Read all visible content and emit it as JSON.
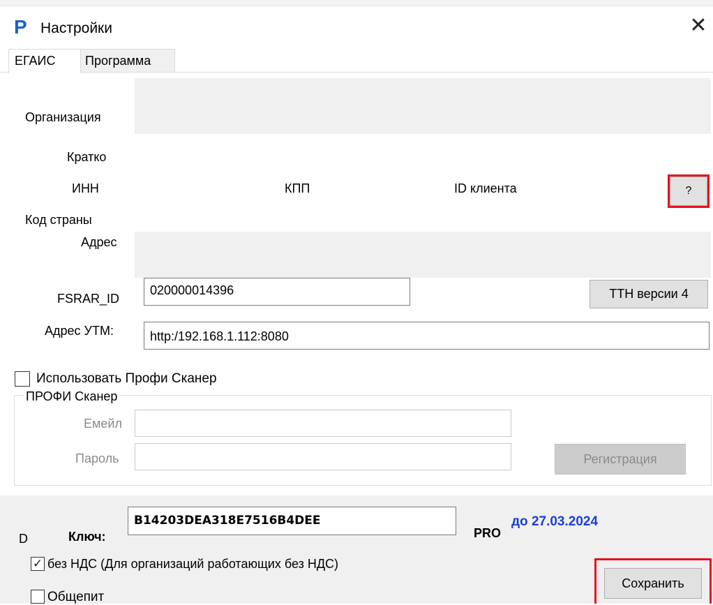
{
  "window": {
    "logo": "P",
    "title": "Настройки",
    "close": "✕"
  },
  "tabs": [
    {
      "label": "ЕГАИС"
    },
    {
      "label": "Программа"
    }
  ],
  "egais": {
    "org_label": "Организация",
    "short_label": "Кратко",
    "inn_label": "ИНН",
    "kpp_label": "КПП",
    "client_id_label": "ID клиента",
    "help_button": "?",
    "country_label": "Код страны",
    "address_label": "Адрес",
    "fsrar_label": "FSRAR_ID",
    "fsrar_value": "020000014396",
    "ttn_button": "ТТН версии 4",
    "utm_label": "Адрес УТМ:",
    "utm_value": "http:/192.168.1.112:8080"
  },
  "profi": {
    "use_checkbox_label": "Использовать Профи Сканер",
    "use_checked": false,
    "group_title": "ПРОФИ Сканер",
    "email_label": "Емейл",
    "email_value": "",
    "password_label": "Пароль",
    "password_value": "",
    "register_button": "Регистрация"
  },
  "license": {
    "d_label": "D",
    "key_label": "Ключ:",
    "key_value": "B14203DEA318E7516B4DEE",
    "edition": "PRO",
    "valid_until": "до 27.03.2024"
  },
  "options": {
    "no_vat_label": "без НДС (Для организаций работающих без НДС)",
    "no_vat_checked": true,
    "catering_label": "Общепит",
    "catering_checked": false
  },
  "save_button": "Сохранить",
  "colors": {
    "accent_blue": "#1663c9",
    "highlight_red": "#e81123",
    "valid_until_blue": "#1a3fd6"
  }
}
